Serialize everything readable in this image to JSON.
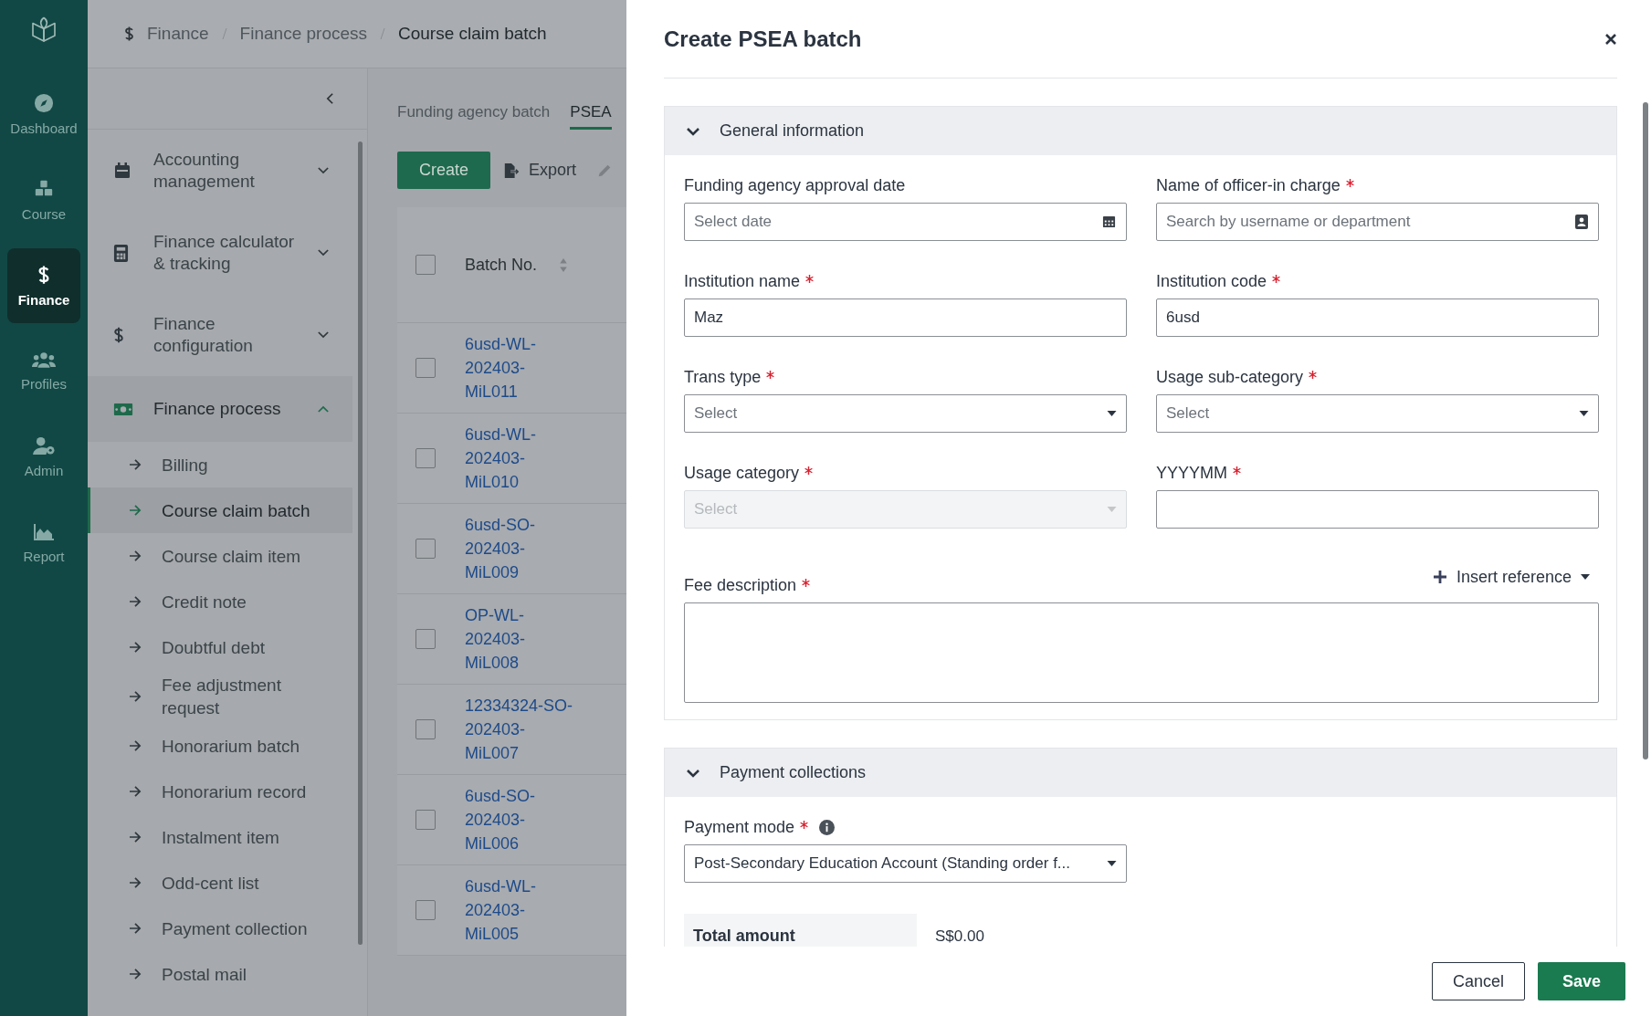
{
  "rail": {
    "items": [
      {
        "label": "Dashboard",
        "selected": false
      },
      {
        "label": "Course",
        "selected": false
      },
      {
        "label": "Finance",
        "selected": true
      },
      {
        "label": "Profiles",
        "selected": false
      },
      {
        "label": "Admin",
        "selected": false
      },
      {
        "label": "Report",
        "selected": false
      }
    ]
  },
  "breadcrumb": [
    "Finance",
    "Finance process",
    "Course claim batch"
  ],
  "sidebar": {
    "groups": [
      {
        "label": "Accounting management",
        "expanded": false
      },
      {
        "label": "Finance calculator & tracking",
        "expanded": false
      },
      {
        "label": "Finance configuration",
        "expanded": false
      },
      {
        "label": "Finance process",
        "expanded": true,
        "children": [
          {
            "label": "Billing",
            "selected": false
          },
          {
            "label": "Course claim batch",
            "selected": true
          },
          {
            "label": "Course claim item",
            "selected": false
          },
          {
            "label": "Credit note",
            "selected": false
          },
          {
            "label": "Doubtful debt",
            "selected": false
          },
          {
            "label": "Fee adjustment request",
            "selected": false
          },
          {
            "label": "Honorarium batch",
            "selected": false
          },
          {
            "label": "Honorarium record",
            "selected": false
          },
          {
            "label": "Instalment item",
            "selected": false
          },
          {
            "label": "Odd-cent list",
            "selected": false
          },
          {
            "label": "Payment collection",
            "selected": false
          },
          {
            "label": "Postal mail",
            "selected": false
          }
        ]
      }
    ]
  },
  "tabs": [
    {
      "label": "Funding agency batch",
      "selected": false
    },
    {
      "label": "PSEA",
      "selected": true
    }
  ],
  "toolbar": {
    "create": "Create",
    "export": "Export"
  },
  "table": {
    "columns": [
      "Batch No."
    ],
    "select_all_checked": false,
    "rows": [
      {
        "batch_no": "6usd-WL-202403-MiL011",
        "checked": false
      },
      {
        "batch_no": "6usd-WL-202403-MiL010",
        "checked": false
      },
      {
        "batch_no": "6usd-SO-202403-MiL009",
        "checked": false
      },
      {
        "batch_no": "OP-WL-202403-MiL008",
        "checked": false
      },
      {
        "batch_no": "12334324-SO-202403-MiL007",
        "checked": false
      },
      {
        "batch_no": "6usd-SO-202403-MiL006",
        "checked": false
      },
      {
        "batch_no": "6usd-WL-202403-MiL005",
        "checked": false
      }
    ]
  },
  "drawer": {
    "title": "Create PSEA batch",
    "sections": [
      {
        "title": "General information",
        "expanded": true,
        "fields": [
          {
            "kind": "date",
            "label": "Funding agency approval date",
            "required": false,
            "placeholder": "Select date"
          },
          {
            "kind": "search",
            "label": "Name of officer-in charge",
            "required": true,
            "placeholder": "Search by username or department"
          },
          {
            "kind": "text",
            "label": "Institution name",
            "required": true,
            "value": "Maz"
          },
          {
            "kind": "text",
            "label": "Institution code",
            "required": true,
            "value": "6usd"
          },
          {
            "kind": "select",
            "label": "Trans type",
            "required": true,
            "placeholder": "Select",
            "disabled": false
          },
          {
            "kind": "select",
            "label": "Usage sub-category",
            "required": true,
            "placeholder": "Select",
            "disabled": false
          },
          {
            "kind": "select",
            "label": "Usage category",
            "required": true,
            "placeholder": "Select",
            "disabled": true
          },
          {
            "kind": "text",
            "label": "YYYYMM",
            "required": true
          },
          {
            "kind": "textarea",
            "label": "Fee description",
            "required": true,
            "action": "Insert reference"
          }
        ]
      },
      {
        "title": "Payment collections",
        "expanded": true,
        "fields": [
          {
            "kind": "select",
            "label": "Payment mode",
            "required": true,
            "info": true,
            "value": "Post-Secondary Education Account (Standing order f...",
            "disabled": false
          }
        ],
        "summary": [
          {
            "label": "Total amount",
            "value": "S$0.00"
          }
        ]
      }
    ],
    "buttons": {
      "cancel": "Cancel",
      "save": "Save"
    }
  }
}
